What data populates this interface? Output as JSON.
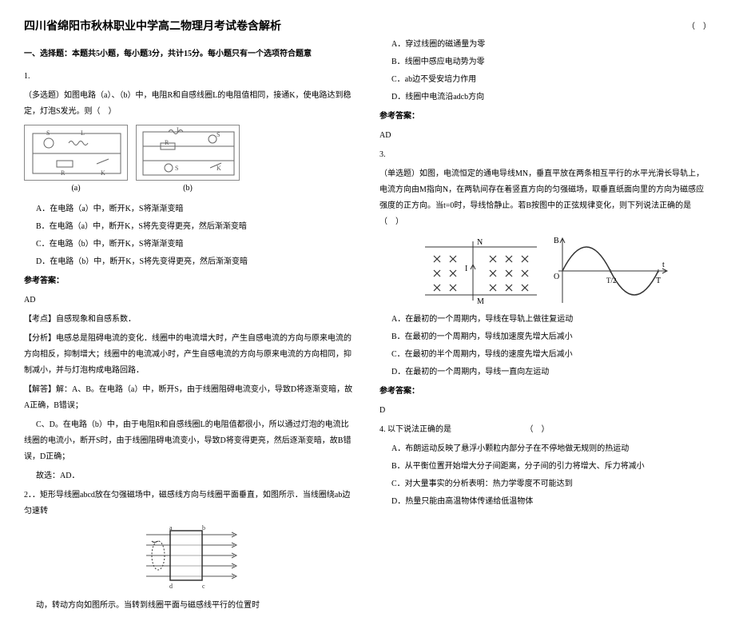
{
  "title": "四川省绵阳市秋林职业中学高二物理月考试卷含解析",
  "section1_header": "一、选择题：本题共5小题，每小题3分，共计15分。每小题只有一个选项符合题意",
  "q1": {
    "num": "1.",
    "stem": "（多选题）如图电路（a）、（b）中，电阻R和自感线圈L的电阻值相同，接通K，使电路达到稳定，灯泡S发光。则（　）",
    "circuit_a_labels": {
      "S": "S",
      "L": "L",
      "R": "R",
      "K": "K",
      "sub": "(a)"
    },
    "circuit_b_labels": {
      "S": "S",
      "L": "L",
      "R": "R",
      "K": "K",
      "S2": "S",
      "sub": "(b)"
    },
    "optA": "A．在电路（a）中，断开K，S将渐渐变暗",
    "optB": "B．在电路（a）中，断开K，S将先变得更亮，然后渐渐变暗",
    "optC": "C．在电路（b）中，断开K，S将渐渐变暗",
    "optD": "D．在电路（b）中，断开K，S将先变得更亮，然后渐渐变暗",
    "ans_label": "参考答案：",
    "ans": "AD",
    "tag1_label": "【考点】",
    "tag1_text": "自感现象和自感系数．",
    "tag2_label": "【分析】",
    "tag2_text": "电感总是阻碍电流的变化．线圈中的电流增大时，产生自感电流的方向与原来电流的方向相反，抑制增大；线圈中的电流减小时，产生自感电流的方向与原来电流的方向相同，抑制减小，并与灯泡构成电路回路．",
    "tag3_label": "【解答】",
    "tag3_text1": "解：A、B。在电路（a）中，断开S，由于线圈阻碍电流变小，导致D将逐渐变暗，故A正确，B错误；",
    "tag3_text2": "C、D。在电路（b）中，由于电阻R和自感线圈L的电阻值都很小，所以通过灯泡的电流比线圈的电流小，断开S时，由于线圈阻碍电流变小，导致D将变得更亮，然后逐渐变暗，故B错误，D正确；",
    "tag3_text3": "故选：AD．"
  },
  "q2": {
    "num": "2．",
    "stem_part1": "．矩形导线圈abcd放在匀强磁场中，磁感线方向与线圈平面垂直，如图所示．当线圈绕ab边匀速转",
    "stem_part2": "动，转动方向如图所示。当转到线圈平面与磁感线平行的位置时",
    "paren": "（　）",
    "optA": "A．穿过线圈的磁通量为零",
    "optB": "B．线圈中感应电动势为零",
    "optC": "C．ab边不受安培力作用",
    "optD": "D．线圈中电流沿adcb方向",
    "ans_label": "参考答案：",
    "ans": "AD"
  },
  "q3": {
    "num": "3.",
    "stem": "（单选题）如图，电流恒定的通电导线MN，垂直平放在两条相互平行的水平光滑长导轨上，电流方向由M指向N，在两轨间存在着竖直方向的匀强磁场，取垂直纸面向里的方向为磁感应强度的正方向。当t=0时，导线恰静止。若B按图中的正弦规律变化，则下列说法正确的是（　）",
    "fig_labels": {
      "N": "N",
      "I": "I",
      "M": "M",
      "B": "B",
      "O": "O",
      "T2": "T/2",
      "T": "T",
      "t": "t"
    },
    "optA": "A．在最初的一个周期内，导线在导轨上做往复运动",
    "optB": "B．在最初的一个周期内，导线加速度先增大后减小",
    "optC": "C．在最初的半个周期内，导线的速度先增大后减小",
    "optD": "D．在最初的一个周期内，导线一直向左运动",
    "ans_label": "参考答案：",
    "ans": "D"
  },
  "q4": {
    "num": "4.",
    "stem": "以下说法正确的是",
    "paren": "（　）",
    "optA": "A．布朗运动反映了悬浮小颗粒内部分子在不停地做无规则的热运动",
    "optB": "B．从平衡位置开始增大分子间距离，分子间的引力将增大、斥力将减小",
    "optC": "C．对大量事实的分析表明：热力学零度不可能达到",
    "optD": "D．热量只能由高温物体传递给低温物体"
  }
}
